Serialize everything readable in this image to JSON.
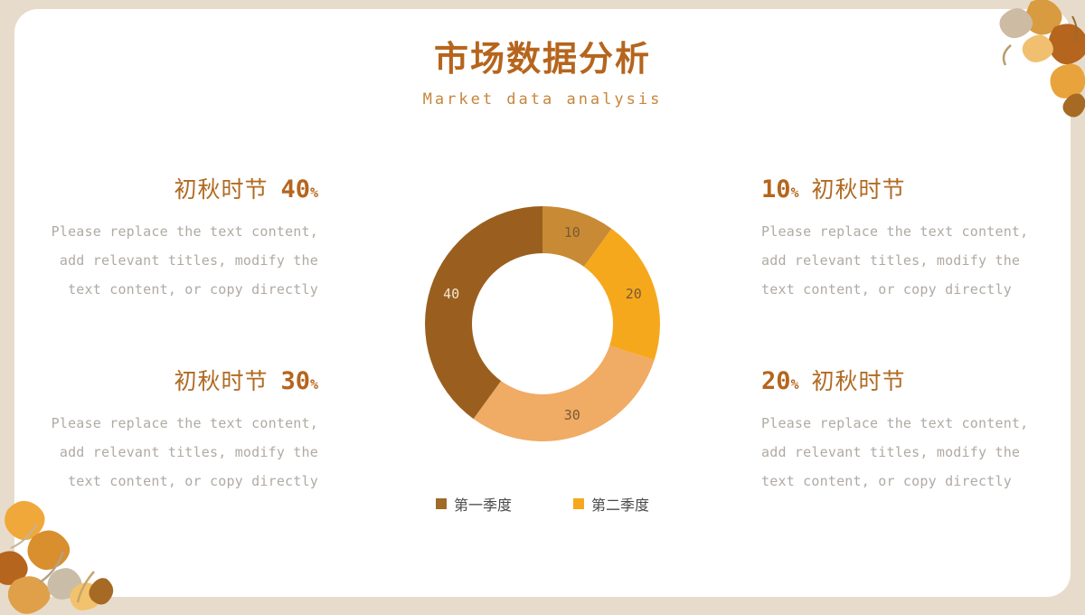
{
  "header": {
    "title": "市场数据分析",
    "subtitle": "Market data analysis"
  },
  "blocks": [
    {
      "label": "初秋时节",
      "percent": "40",
      "percent_symbol": "%",
      "body": "Please replace the text content, add relevant titles, modify the text content, or copy directly"
    },
    {
      "label": "初秋时节",
      "percent": "30",
      "percent_symbol": "%",
      "body": "Please replace the text content, add relevant titles, modify the text content, or copy directly"
    },
    {
      "label": "初秋时节",
      "percent": "10",
      "percent_symbol": "%",
      "body": "Please replace the text content, add relevant titles, modify the text content, or copy directly"
    },
    {
      "label": "初秋时节",
      "percent": "20",
      "percent_symbol": "%",
      "body": "Please replace the text content, add relevant titles, modify the text content, or copy directly"
    }
  ],
  "legend": [
    {
      "label": "第一季度",
      "color": "#a06a29"
    },
    {
      "label": "第二季度",
      "color": "#f6a81c"
    }
  ],
  "chart_data": {
    "type": "pie",
    "title": "市场数据分析",
    "subtitle": "Market data analysis",
    "donut": true,
    "labels": [
      "10",
      "20",
      "30",
      "40"
    ],
    "values": [
      10,
      20,
      30,
      40
    ],
    "data_labels": [
      "10",
      "20",
      "30",
      "40"
    ],
    "colors": [
      "#c88a34",
      "#f6a81c",
      "#f0ab64",
      "#9a5f1f"
    ],
    "legend": [
      "第一季度",
      "第二季度"
    ],
    "legend_position": "bottom",
    "grid": false,
    "xlabel": "",
    "ylabel": ""
  },
  "colors": {
    "accent": "#b5651d",
    "subtitle": "#c8853b",
    "body_text": "#b0aaa4",
    "card_bg": "#ffffff",
    "page_bg": "#e7dccb"
  }
}
